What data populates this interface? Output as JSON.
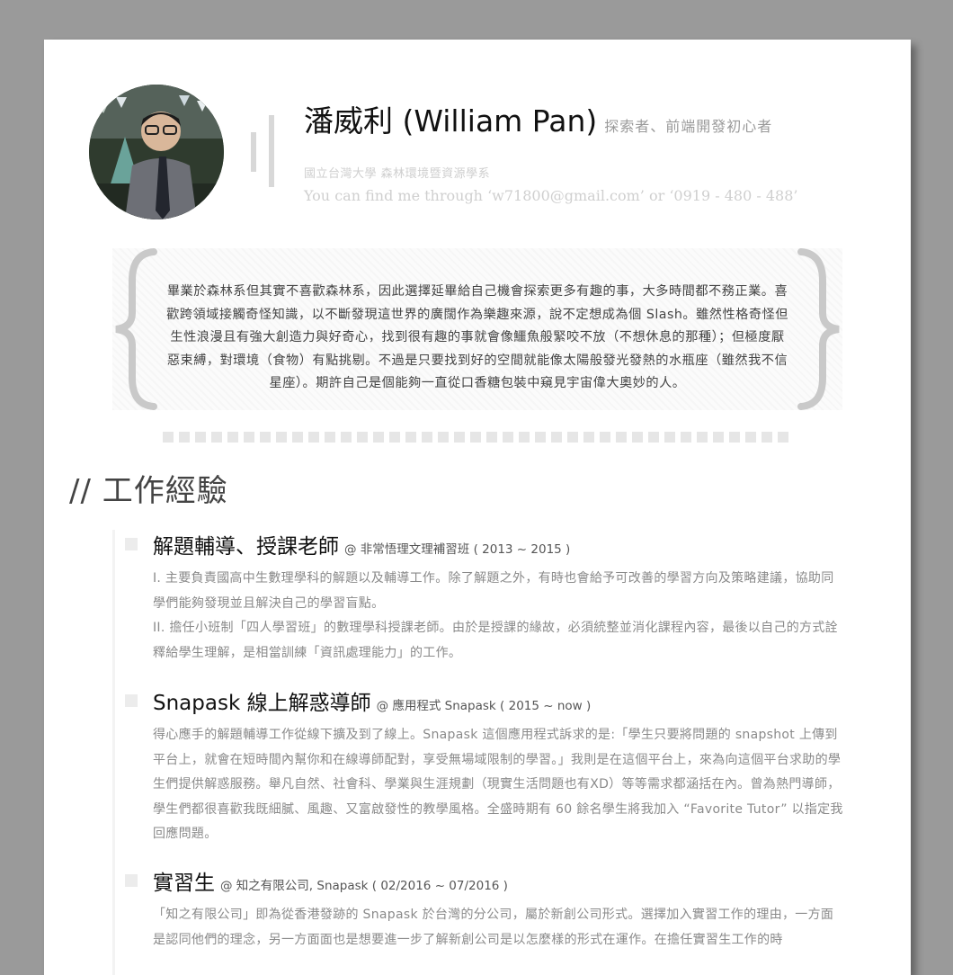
{
  "profile": {
    "name": "潘威利 (William Pan)",
    "tagline": "探索者、前端開發初心者",
    "school": "國立台灣大學 森林環境暨資源學系",
    "contact": "You can find me through ‘w71800@gmail.com’ or ‘0919 - 480 - 488’"
  },
  "bio": {
    "text": "畢業於森林系但其實不喜歡森林系，因此選擇延畢給自己機會探索更多有趣的事，大多時間都不務正業。喜歡跨領域接觸奇怪知識，以不斷發現這世界的廣闊作為樂趣來源，說不定想成為個 Slash。雖然性格奇怪但生性浪漫且有強大創造力與好奇心，找到很有趣的事就會像鱷魚般緊咬不放（不想休息的那種）；但極度厭惡束縛，對環境（食物）有點挑剔。不過是只要找到好的空間就能像太陽般發光發熱的水瓶座（雖然我不信星座）。期許自己是個能夠一直從口香糖包裝中窺見宇宙偉大奧妙的人。",
    "brace_left": "{",
    "brace_right": "}"
  },
  "section": {
    "title": "// 工作經驗"
  },
  "jobs": [
    {
      "title": "解題輔導、授課老師",
      "at": "@ 非常悟理文理補習班 ( 2013 ~ 2015 )",
      "paragraphs": [
        "I. 主要負責國高中生數理學科的解題以及輔導工作。除了解題之外，有時也會給予可改善的學習方向及策略建議，協助同學們能夠發現並且解決自己的學習盲點。",
        "II. 擔任小班制「四人學習班」的數理學科授課老師。由於是授課的緣故，必須統整並消化課程內容，最後以自己的方式詮釋給學生理解，是相當訓練「資訊處理能力」的工作。"
      ]
    },
    {
      "title": "Snapask 線上解惑導師",
      "at": "@ 應用程式 Snapask ( 2015 ~ now )",
      "paragraphs": [
        "得心應手的解題輔導工作從線下擴及到了線上。Snapask 這個應用程式訴求的是:「學生只要將問題的 snapshot 上傳到平台上，就會在短時間內幫你和在線導師配對，享受無場域限制的學習。」我則是在這個平台上，來為向這個平台求助的學生們提供解惑服務。舉凡自然、社會科、學業與生涯規劃（現實生活問題也有XD）等等需求都涵括在內。曾為熱門導師，學生們都很喜歡我既細膩、風趣、又富啟發性的教學風格。全盛時期有 60 餘名學生將我加入 “Favorite Tutor” 以指定我回應問題。"
      ]
    },
    {
      "title": "實習生",
      "at": "@ 知之有限公司, Snapask ( 02/2016 ~ 07/2016 )",
      "paragraphs": [
        "「知之有限公司」即為從香港發跡的 Snapask 於台灣的分公司，屬於新創公司形式。選擇加入實習工作的理由，一方面是認同他們的理念，另一方面面也是想要進一步了解新創公司是以怎麼樣的形式在運作。在擔任實習生工作的時"
      ]
    }
  ]
}
